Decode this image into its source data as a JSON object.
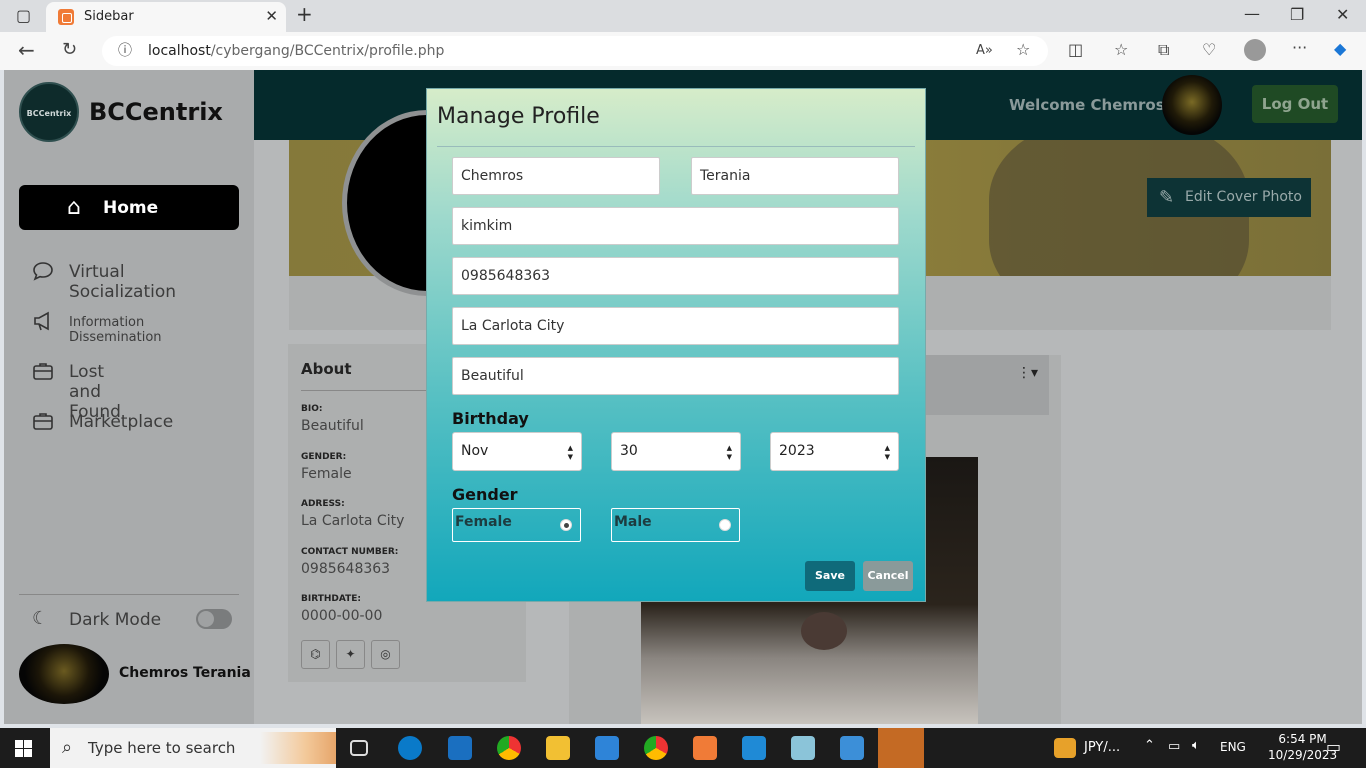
{
  "browser": {
    "tab_title": "Sidebar",
    "url_host": "localhost",
    "url_path": "/cybergang/BCCentrix/profile.php"
  },
  "sidebar": {
    "logo_text": "BCCentrix",
    "brand": "BCCentrix",
    "home_label": "Home",
    "items": [
      {
        "label": "Virtual Socialization",
        "icon": "chat-icon"
      },
      {
        "label": "Information Dissemination",
        "icon": "megaphone-icon"
      },
      {
        "label": "Lost and Found",
        "icon": "briefcase-icon"
      },
      {
        "label": "Marketplace",
        "icon": "briefcase-icon"
      }
    ],
    "dark_mode_label": "Dark Mode",
    "user_name": "Chemros Terania"
  },
  "header": {
    "welcome": "Welcome Chemros!",
    "logout": "Log Out",
    "edit_cover": "Edit Cover Photo"
  },
  "about": {
    "title": "About",
    "bio_label": "BIO:",
    "bio": "Beautiful",
    "gender_label": "GENDER:",
    "gender": "Female",
    "address_label": "ADRESS:",
    "address": "La Carlota City",
    "contact_label": "CONTACT NUMBER:",
    "contact": "0985648363",
    "birthdate_label": "BIRTHDATE:",
    "birthdate": "0000-00-00"
  },
  "modal": {
    "title": "Manage Profile",
    "first_name": "Chemros",
    "last_name": "Terania",
    "username": "kimkim",
    "contact": "0985648363",
    "address": "La Carlota City",
    "bio": "Beautiful",
    "birthday_label": "Birthday",
    "birth_month": "Nov",
    "birth_day": "30",
    "birth_year": "2023",
    "gender_label": "Gender",
    "gender_options": [
      "Female",
      "Male"
    ],
    "gender_selected": "Female",
    "save": "Save",
    "cancel": "Cancel"
  },
  "taskbar": {
    "search_placeholder": "Type here to search",
    "currency": "JPY/...",
    "lang": "ENG",
    "time": "6:54 PM",
    "date": "10/29/2023"
  }
}
